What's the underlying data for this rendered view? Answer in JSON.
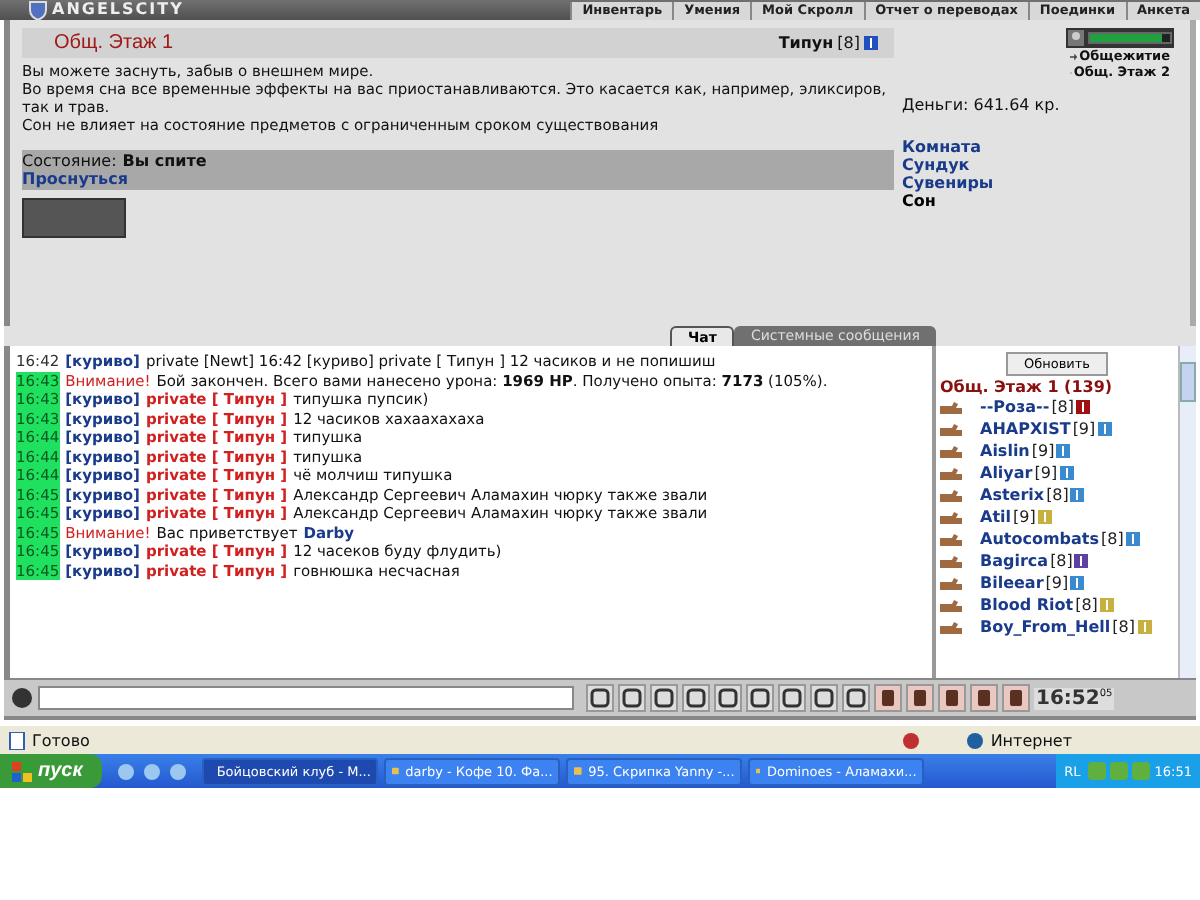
{
  "header": {
    "logo": "ANGELSCITY",
    "nav": [
      "Инвентарь",
      "Умения",
      "Мой Скролл",
      "Отчет о переводах",
      "Поединки",
      "Анкета"
    ]
  },
  "room": {
    "title": "Общ. Этаж 1",
    "player": {
      "name": "Типун",
      "level": "[8]"
    },
    "paragraphs": [
      "Вы можете заснуть, забыв о внешнем мире.",
      "Во время сна все временные эффекты на вас приостанавливаются. Это касается как, например, эликсиров, так и трав.",
      "Сон не влияет на состояние предметов с ограниченным сроком существования"
    ],
    "state_label": "Состояние:",
    "state_value": "Вы спите",
    "wake_link": "Проснуться"
  },
  "side": {
    "hp": {
      "level": 0.9
    },
    "exits": [
      "Общежитие",
      "Общ. Этаж 2"
    ],
    "money": "Деньги: 641.64 кр.",
    "links": [
      {
        "label": "Комната",
        "selected": false
      },
      {
        "label": "Сундук",
        "selected": false
      },
      {
        "label": "Сувениры",
        "selected": false
      },
      {
        "label": "Сон",
        "selected": true
      }
    ]
  },
  "chat": {
    "tabs": [
      {
        "label": "Чат",
        "selected": true
      },
      {
        "label": "Системные сообщения",
        "selected": false
      }
    ],
    "messages": [
      {
        "kind": "plain",
        "time": "16:42",
        "new": false,
        "sender": "[куриво]",
        "text": "private [Newt] 16:42 [куриво] private [ Типун ] 12 часиков и не попишиш"
      },
      {
        "kind": "system",
        "time": "16:43",
        "new": true,
        "label": "Внимание!",
        "text": "Бой закончен. Всего вами нанесено урона: **1969 HP**. Получено опыта: **7173** (105%)."
      },
      {
        "kind": "private",
        "time": "16:43",
        "new": true,
        "sender": "[куриво]",
        "target": "private [ Типун ]",
        "text": "типушка пупсик)"
      },
      {
        "kind": "private",
        "time": "16:43",
        "new": true,
        "sender": "[куриво]",
        "target": "private [ Типун ]",
        "text": "12 часиков хахаахахаха"
      },
      {
        "kind": "private",
        "time": "16:44",
        "new": true,
        "sender": "[куриво]",
        "target": "private [ Типун ]",
        "text": "типушка"
      },
      {
        "kind": "private",
        "time": "16:44",
        "new": true,
        "sender": "[куриво]",
        "target": "private [ Типун ]",
        "text": "типушка"
      },
      {
        "kind": "private",
        "time": "16:44",
        "new": true,
        "sender": "[куриво]",
        "target": "private [ Типун ]",
        "text": "чё молчиш типушка"
      },
      {
        "kind": "private",
        "time": "16:45",
        "new": true,
        "sender": "[куриво]",
        "target": "private [ Типун ]",
        "text": "Александр Сергеевич Аламахин чюрку также звали"
      },
      {
        "kind": "private",
        "time": "16:45",
        "new": true,
        "sender": "[куриво]",
        "target": "private [ Типун ]",
        "text": "Александр Сергеевич Аламахин чюрку также звали"
      },
      {
        "kind": "system",
        "time": "16:45",
        "new": true,
        "label": "Внимание!",
        "text": "Вас приветствует",
        "name": "Darby"
      },
      {
        "kind": "private",
        "time": "16:45",
        "new": true,
        "sender": "[куриво]",
        "target": "private [ Типун ]",
        "text": "12 часеков буду флудить)"
      },
      {
        "kind": "private",
        "time": "16:45",
        "new": true,
        "sender": "[куриво]",
        "target": "private [ Типун ]",
        "text": "говнюшка несчасная"
      }
    ]
  },
  "users": {
    "refresh": "Обновить",
    "title": "Общ. Этаж 1 (139)",
    "items": [
      {
        "name": "--Роза--",
        "level": "[8]",
        "color": "#a01010"
      },
      {
        "name": "AHAPXIST",
        "level": "[9]",
        "color": "#3a8ad0"
      },
      {
        "name": "Aislin",
        "level": "[9]",
        "color": "#3a8ad0"
      },
      {
        "name": "Aliyar",
        "level": "[9]",
        "color": "#3a8ad0"
      },
      {
        "name": "Asterix",
        "level": "[8]",
        "color": "#3a8ad0"
      },
      {
        "name": "Atil",
        "level": "[9]",
        "color": "#c8b040"
      },
      {
        "name": "Autocombats",
        "level": "[8]",
        "color": "#3a8ad0"
      },
      {
        "name": "Bagirca",
        "level": "[8]",
        "color": "#6040a0"
      },
      {
        "name": "Bileear",
        "level": "[9]",
        "color": "#3a8ad0"
      },
      {
        "name": "Blood Riot",
        "level": "[8]",
        "color": "#c8b040"
      },
      {
        "name": "Boy_From_Hell",
        "level": "[8]",
        "color": "#c8b040"
      }
    ]
  },
  "toolbar": {
    "clock": "16:52",
    "clock_seconds": "05"
  },
  "status_bar": {
    "text": "Готово",
    "zone": "Интернет"
  },
  "taskbar": {
    "start": "пуск",
    "tasks": [
      {
        "label": "Бойцовский клуб - М...",
        "selected": true
      },
      {
        "label": "darby - Кофе 10. Фа...",
        "selected": false
      },
      {
        "label": "95. Скрипка Yanny -...",
        "selected": false
      },
      {
        "label": "Dominoes - Аламахи...",
        "selected": false
      }
    ],
    "lang": "RL",
    "time": "16:51"
  }
}
